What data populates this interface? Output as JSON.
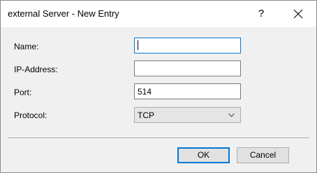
{
  "dialog": {
    "title": "external Server - New Entry",
    "help_glyph": "?",
    "close_icon": "close-icon"
  },
  "form": {
    "name": {
      "label": "Name:",
      "value": ""
    },
    "ip": {
      "label": "IP-Address:",
      "value": ""
    },
    "port": {
      "label": "Port:",
      "value": "514"
    },
    "protocol": {
      "label": "Protocol:",
      "value": "TCP",
      "dropdown_icon": "chevron-down-icon"
    }
  },
  "buttons": {
    "ok": "OK",
    "cancel": "Cancel"
  },
  "colors": {
    "accent": "#0078d7",
    "window_bg": "#f0f0f0"
  }
}
